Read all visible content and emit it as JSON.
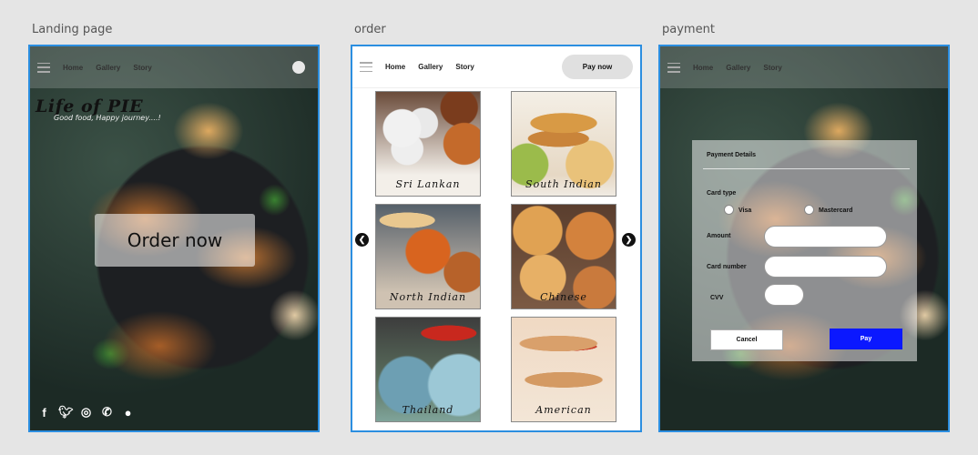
{
  "frames": {
    "landing": "Landing page",
    "order": "order",
    "payment": "payment"
  },
  "nav": {
    "home": "Home",
    "gallery": "Gallery",
    "story": "Story"
  },
  "landing": {
    "brand": "Life of PIE",
    "tagline": "Good food, Happy journey....!",
    "order_button": "Order now",
    "social_icons": [
      "facebook-icon",
      "twitter-icon",
      "instagram-icon",
      "phone-icon",
      "chat-icon"
    ]
  },
  "order": {
    "pay_now": "Pay now",
    "cuisines": [
      "Sri Lankan",
      "South Indian",
      "North Indian",
      "Chinese",
      "Thailand",
      "American"
    ]
  },
  "payment": {
    "title": "Payment Details",
    "card_type_label": "Card type",
    "visa": "Visa",
    "mastercard": "Mastercard",
    "amount_label": "Amount",
    "card_number_label": "Card number",
    "cvv_label": "CVV",
    "cancel": "Cancel",
    "pay": "Pay"
  },
  "colors": {
    "artboard_border": "#2b8ee0",
    "pay_button": "#0b18ff"
  }
}
